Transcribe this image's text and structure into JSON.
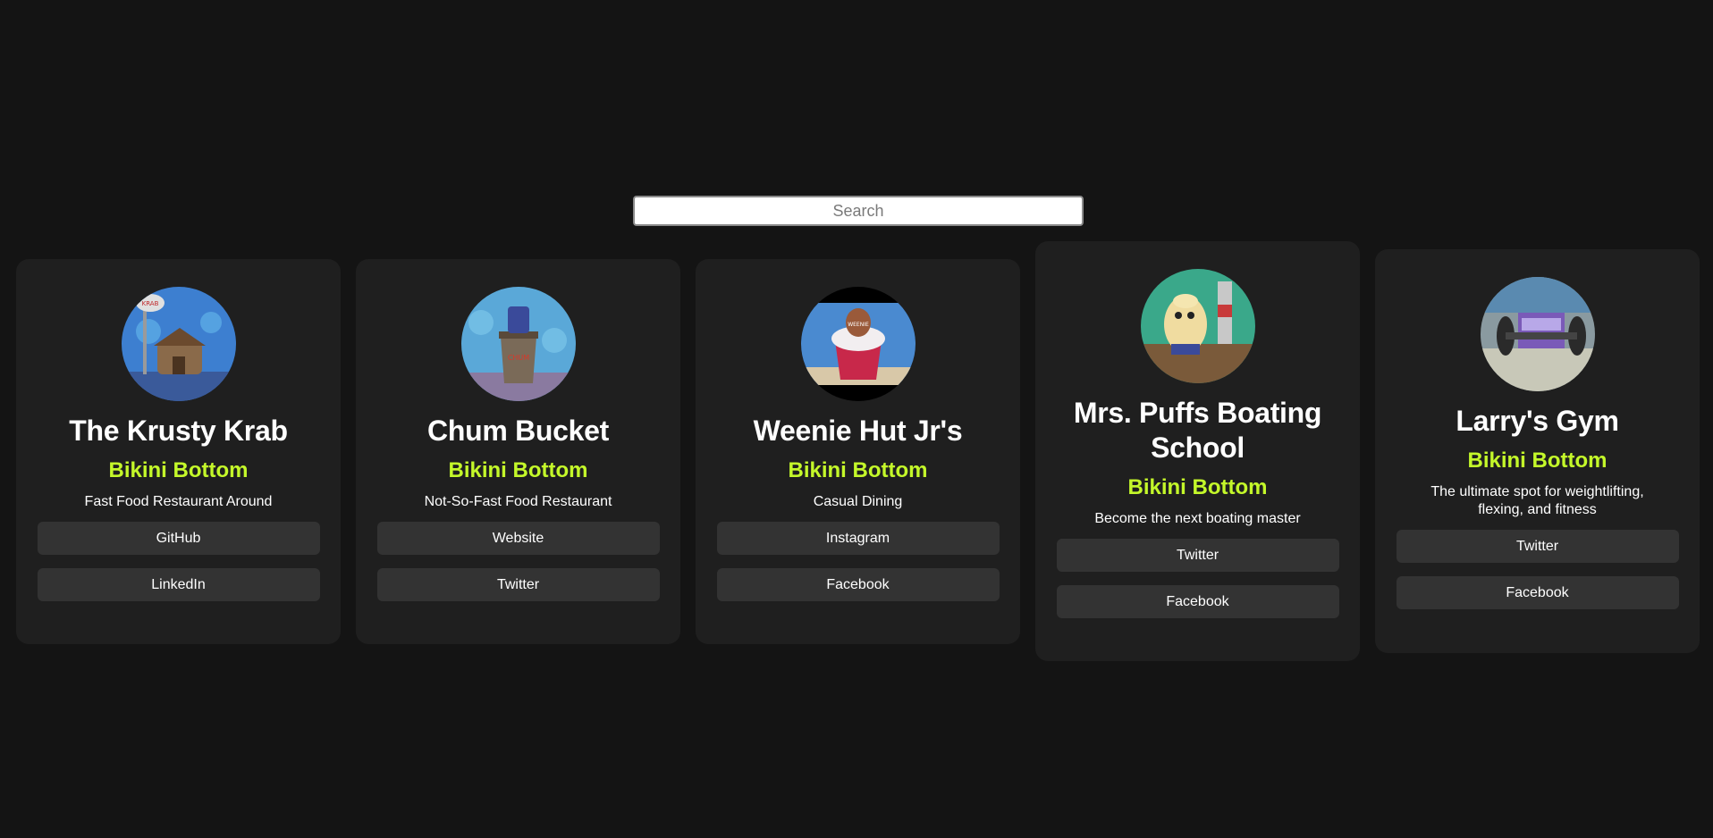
{
  "search": {
    "placeholder": "Search",
    "value": ""
  },
  "cards": [
    {
      "name": "The Krusty Krab",
      "city": "Bikini Bottom",
      "bio": "Fast Food Restaurant Around",
      "links": [
        "GitHub",
        "LinkedIn"
      ],
      "avatar_icon": "krusty-krab-image"
    },
    {
      "name": "Chum Bucket",
      "city": "Bikini Bottom",
      "bio": "Not-So-Fast Food Restaurant",
      "links": [
        "Website",
        "Twitter"
      ],
      "avatar_icon": "chum-bucket-image"
    },
    {
      "name": "Weenie Hut Jr's",
      "city": "Bikini Bottom",
      "bio": "Casual Dining",
      "links": [
        "Instagram",
        "Facebook"
      ],
      "avatar_icon": "weenie-hut-image"
    },
    {
      "name": "Mrs. Puffs Boating School",
      "city": "Bikini Bottom",
      "bio": "Become the next boating master",
      "links": [
        "Twitter",
        "Facebook"
      ],
      "avatar_icon": "mrs-puff-image"
    },
    {
      "name": "Larry's Gym",
      "city": "Bikini Bottom",
      "bio": "The ultimate spot for weightlifting, flexing, and fitness",
      "links": [
        "Twitter",
        "Facebook"
      ],
      "avatar_icon": "larrys-gym-image"
    }
  ],
  "colors": {
    "background": "#141414",
    "card": "#1f1f1f",
    "accent": "#c4f82a",
    "button": "#333333"
  }
}
